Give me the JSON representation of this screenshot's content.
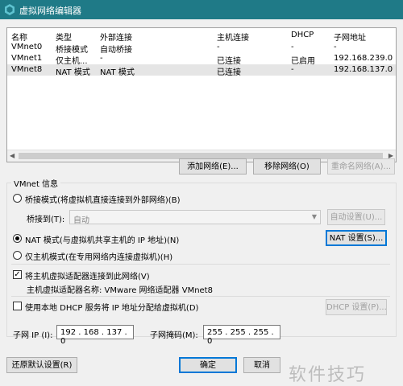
{
  "window": {
    "title": "虚拟网络编辑器",
    "icon": "vmware-icon"
  },
  "table": {
    "headers": [
      "名称",
      "类型",
      "外部连接",
      "主机连接",
      "DHCP",
      "子网地址"
    ],
    "rows": [
      [
        "VMnet0",
        "桥接模式",
        "自动桥接",
        "-",
        "-",
        "-"
      ],
      [
        "VMnet1",
        "仅主机...",
        "-",
        "已连接",
        "已启用",
        "192.168.239.0"
      ],
      [
        "VMnet8",
        "NAT 模式",
        "NAT 模式",
        "已连接",
        "-",
        "192.168.137.0"
      ]
    ]
  },
  "buttons": {
    "add": "添加网络(E)...",
    "remove": "移除网络(O)",
    "rename": "重命名网络(A)...",
    "auto": "自动设置(U)...",
    "nat": "NAT 设置(S)...",
    "dhcp": "DHCP 设置(P)...",
    "restore": "还原默认设置(R)",
    "ok": "确定",
    "cancel": "取消"
  },
  "vmnet_info": {
    "title": "VMnet 信息",
    "bridge_mode": "桥接模式(将虚拟机直接连接到外部网络)(B)",
    "bridge_to_label": "桥接到(T):",
    "bridge_to_value": "自动",
    "nat_mode": "NAT 模式(与虚拟机共享主机的 IP 地址)(N)",
    "host_only": "仅主机模式(在专用网络内连接虚拟机)(H)",
    "connect_adapter": "将主机虚拟适配器连接到此网络(V)",
    "adapter_name": "主机虚拟适配器名称: VMware 网络适配器 VMnet8",
    "use_dhcp": "使用本地 DHCP 服务将 IP 地址分配给虚拟机(D)",
    "subnet_ip_label": "子网 IP (I):",
    "subnet_ip": "192 . 168 . 137 . 0",
    "subnet_mask_label": "子网掩码(M):",
    "subnet_mask": "255 . 255 . 255 . 0"
  },
  "watermark": "软件技巧",
  "colors": {
    "titlebar": "#1f7a87",
    "selection": "#e5e5e5",
    "focus": "#0078d7"
  }
}
